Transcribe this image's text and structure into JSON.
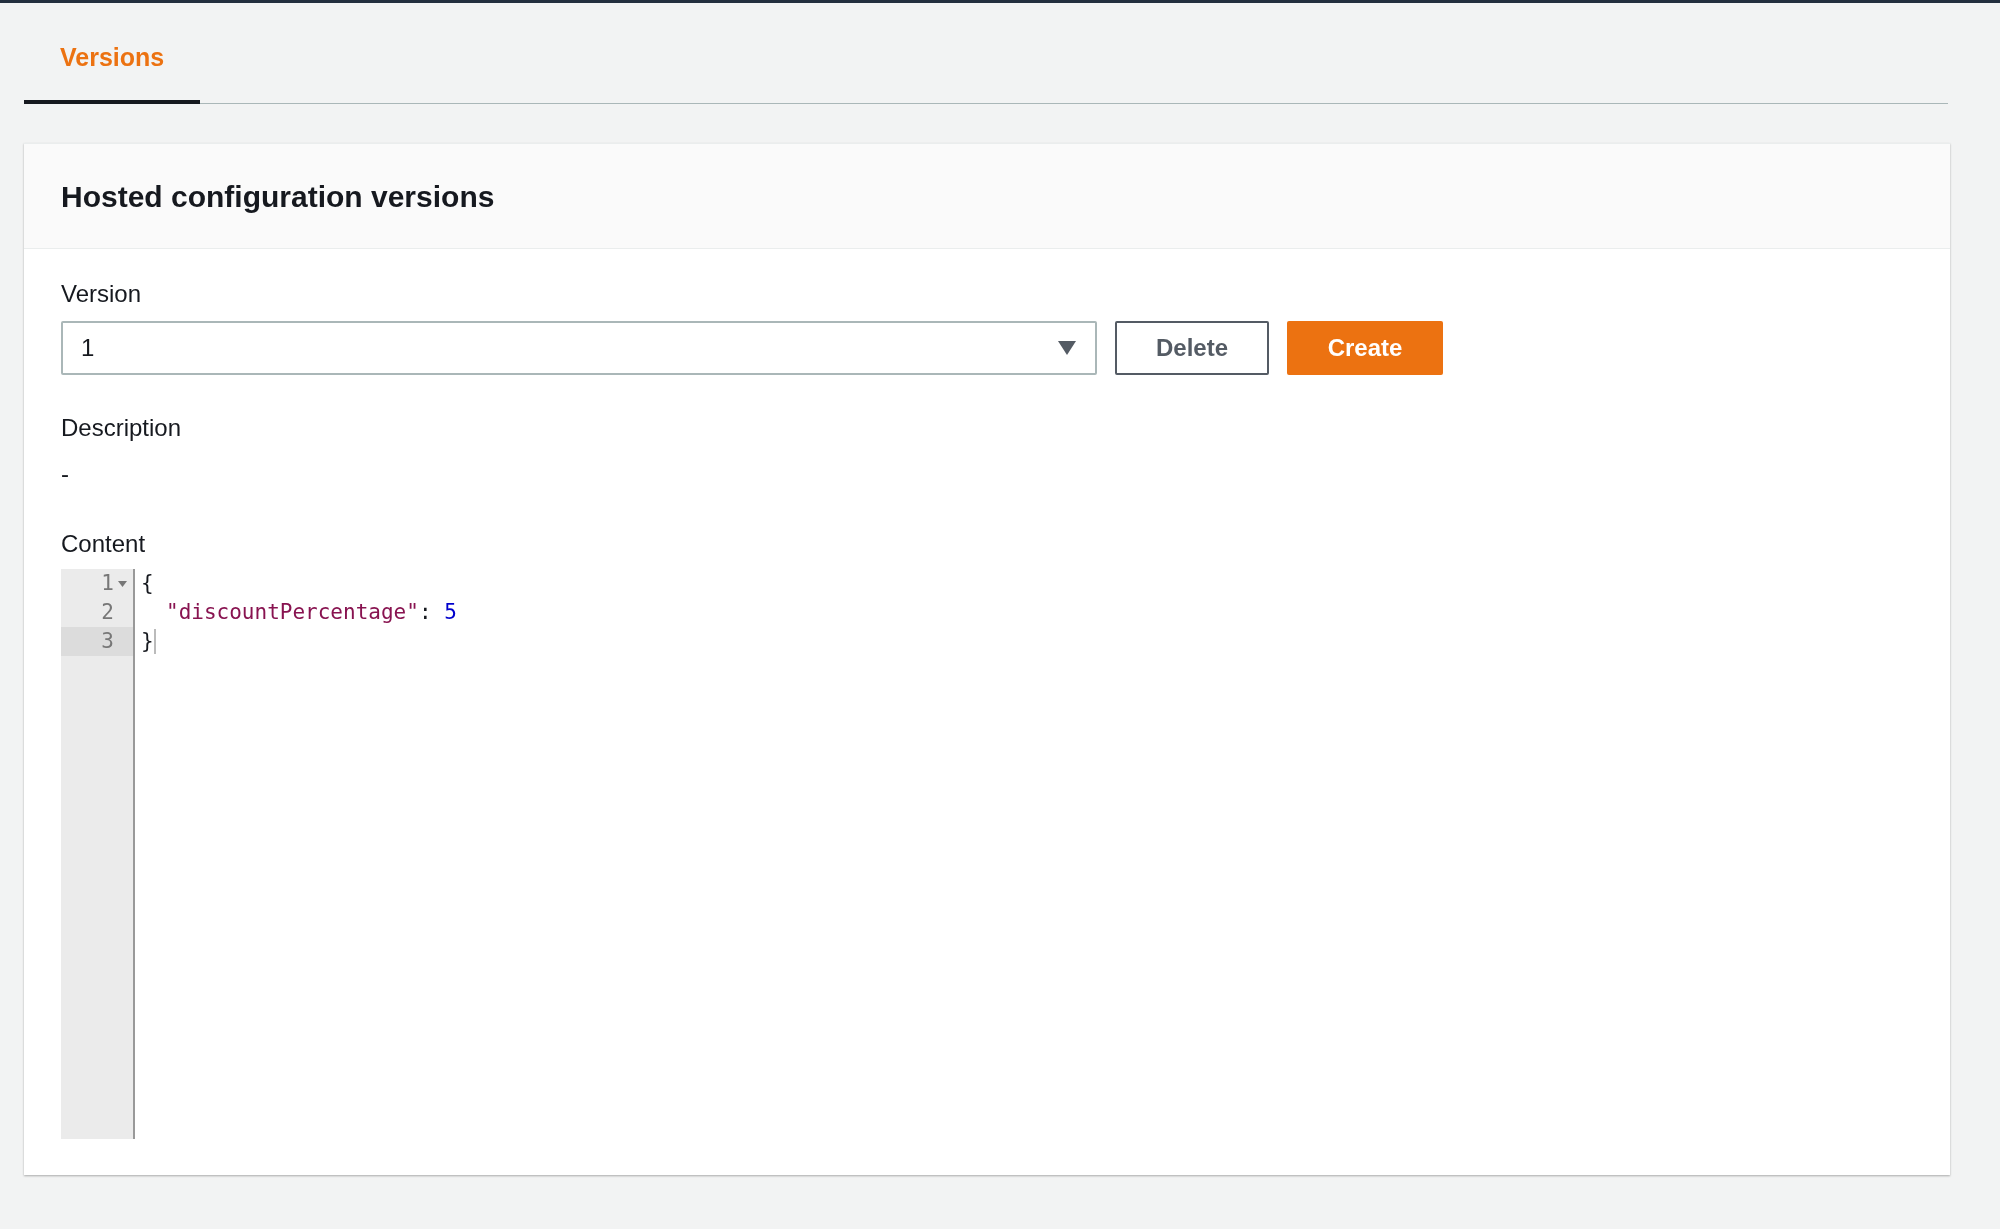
{
  "tabs": [
    {
      "label": "Versions",
      "selected": true
    }
  ],
  "panel": {
    "title": "Hosted configuration versions",
    "version": {
      "label": "Version",
      "value": "1"
    },
    "buttons": [
      {
        "label": "Delete",
        "kind": "normal"
      },
      {
        "label": "Create",
        "kind": "primary"
      }
    ],
    "description": {
      "label": "Description",
      "value": "-"
    },
    "content": {
      "label": "Content",
      "lines": [
        {
          "number": "1",
          "foldable": true,
          "active": false,
          "indented": false,
          "tokens": [
            {
              "kind": "punctuation",
              "text": "{"
            }
          ]
        },
        {
          "number": "2",
          "foldable": false,
          "active": false,
          "indented": true,
          "tokens": [
            {
              "kind": "string",
              "text": "\"discountPercentage\""
            },
            {
              "kind": "punctuation",
              "text": ": "
            },
            {
              "kind": "number",
              "text": "5"
            }
          ]
        },
        {
          "number": "3",
          "foldable": false,
          "active": true,
          "indented": false,
          "tokens": [
            {
              "kind": "punctuation",
              "text": "}"
            }
          ]
        }
      ]
    }
  }
}
